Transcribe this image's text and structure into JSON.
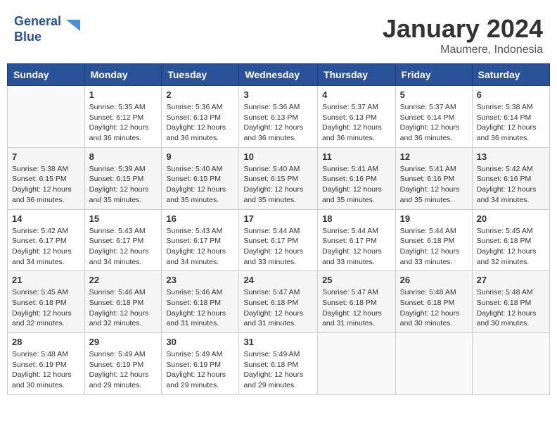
{
  "header": {
    "logo_line1": "General",
    "logo_line2": "Blue",
    "month_title": "January 2024",
    "subtitle": "Maumere, Indonesia"
  },
  "days_of_week": [
    "Sunday",
    "Monday",
    "Tuesday",
    "Wednesday",
    "Thursday",
    "Friday",
    "Saturday"
  ],
  "weeks": [
    [
      {
        "day": "",
        "sunrise": "",
        "sunset": "",
        "daylight": ""
      },
      {
        "day": "1",
        "sunrise": "Sunrise: 5:35 AM",
        "sunset": "Sunset: 6:12 PM",
        "daylight": "Daylight: 12 hours and 36 minutes."
      },
      {
        "day": "2",
        "sunrise": "Sunrise: 5:36 AM",
        "sunset": "Sunset: 6:13 PM",
        "daylight": "Daylight: 12 hours and 36 minutes."
      },
      {
        "day": "3",
        "sunrise": "Sunrise: 5:36 AM",
        "sunset": "Sunset: 6:13 PM",
        "daylight": "Daylight: 12 hours and 36 minutes."
      },
      {
        "day": "4",
        "sunrise": "Sunrise: 5:37 AM",
        "sunset": "Sunset: 6:13 PM",
        "daylight": "Daylight: 12 hours and 36 minutes."
      },
      {
        "day": "5",
        "sunrise": "Sunrise: 5:37 AM",
        "sunset": "Sunset: 6:14 PM",
        "daylight": "Daylight: 12 hours and 36 minutes."
      },
      {
        "day": "6",
        "sunrise": "Sunrise: 5:38 AM",
        "sunset": "Sunset: 6:14 PM",
        "daylight": "Daylight: 12 hours and 36 minutes."
      }
    ],
    [
      {
        "day": "7",
        "sunrise": "Sunrise: 5:38 AM",
        "sunset": "Sunset: 6:15 PM",
        "daylight": "Daylight: 12 hours and 36 minutes."
      },
      {
        "day": "8",
        "sunrise": "Sunrise: 5:39 AM",
        "sunset": "Sunset: 6:15 PM",
        "daylight": "Daylight: 12 hours and 35 minutes."
      },
      {
        "day": "9",
        "sunrise": "Sunrise: 5:40 AM",
        "sunset": "Sunset: 6:15 PM",
        "daylight": "Daylight: 12 hours and 35 minutes."
      },
      {
        "day": "10",
        "sunrise": "Sunrise: 5:40 AM",
        "sunset": "Sunset: 6:15 PM",
        "daylight": "Daylight: 12 hours and 35 minutes."
      },
      {
        "day": "11",
        "sunrise": "Sunrise: 5:41 AM",
        "sunset": "Sunset: 6:16 PM",
        "daylight": "Daylight: 12 hours and 35 minutes."
      },
      {
        "day": "12",
        "sunrise": "Sunrise: 5:41 AM",
        "sunset": "Sunset: 6:16 PM",
        "daylight": "Daylight: 12 hours and 35 minutes."
      },
      {
        "day": "13",
        "sunrise": "Sunrise: 5:42 AM",
        "sunset": "Sunset: 6:16 PM",
        "daylight": "Daylight: 12 hours and 34 minutes."
      }
    ],
    [
      {
        "day": "14",
        "sunrise": "Sunrise: 5:42 AM",
        "sunset": "Sunset: 6:17 PM",
        "daylight": "Daylight: 12 hours and 34 minutes."
      },
      {
        "day": "15",
        "sunrise": "Sunrise: 5:43 AM",
        "sunset": "Sunset: 6:17 PM",
        "daylight": "Daylight: 12 hours and 34 minutes."
      },
      {
        "day": "16",
        "sunrise": "Sunrise: 5:43 AM",
        "sunset": "Sunset: 6:17 PM",
        "daylight": "Daylight: 12 hours and 34 minutes."
      },
      {
        "day": "17",
        "sunrise": "Sunrise: 5:44 AM",
        "sunset": "Sunset: 6:17 PM",
        "daylight": "Daylight: 12 hours and 33 minutes."
      },
      {
        "day": "18",
        "sunrise": "Sunrise: 5:44 AM",
        "sunset": "Sunset: 6:17 PM",
        "daylight": "Daylight: 12 hours and 33 minutes."
      },
      {
        "day": "19",
        "sunrise": "Sunrise: 5:44 AM",
        "sunset": "Sunset: 6:18 PM",
        "daylight": "Daylight: 12 hours and 33 minutes."
      },
      {
        "day": "20",
        "sunrise": "Sunrise: 5:45 AM",
        "sunset": "Sunset: 6:18 PM",
        "daylight": "Daylight: 12 hours and 32 minutes."
      }
    ],
    [
      {
        "day": "21",
        "sunrise": "Sunrise: 5:45 AM",
        "sunset": "Sunset: 6:18 PM",
        "daylight": "Daylight: 12 hours and 32 minutes."
      },
      {
        "day": "22",
        "sunrise": "Sunrise: 5:46 AM",
        "sunset": "Sunset: 6:18 PM",
        "daylight": "Daylight: 12 hours and 32 minutes."
      },
      {
        "day": "23",
        "sunrise": "Sunrise: 5:46 AM",
        "sunset": "Sunset: 6:18 PM",
        "daylight": "Daylight: 12 hours and 31 minutes."
      },
      {
        "day": "24",
        "sunrise": "Sunrise: 5:47 AM",
        "sunset": "Sunset: 6:18 PM",
        "daylight": "Daylight: 12 hours and 31 minutes."
      },
      {
        "day": "25",
        "sunrise": "Sunrise: 5:47 AM",
        "sunset": "Sunset: 6:18 PM",
        "daylight": "Daylight: 12 hours and 31 minutes."
      },
      {
        "day": "26",
        "sunrise": "Sunrise: 5:48 AM",
        "sunset": "Sunset: 6:18 PM",
        "daylight": "Daylight: 12 hours and 30 minutes."
      },
      {
        "day": "27",
        "sunrise": "Sunrise: 5:48 AM",
        "sunset": "Sunset: 6:18 PM",
        "daylight": "Daylight: 12 hours and 30 minutes."
      }
    ],
    [
      {
        "day": "28",
        "sunrise": "Sunrise: 5:48 AM",
        "sunset": "Sunset: 6:19 PM",
        "daylight": "Daylight: 12 hours and 30 minutes."
      },
      {
        "day": "29",
        "sunrise": "Sunrise: 5:49 AM",
        "sunset": "Sunset: 6:19 PM",
        "daylight": "Daylight: 12 hours and 29 minutes."
      },
      {
        "day": "30",
        "sunrise": "Sunrise: 5:49 AM",
        "sunset": "Sunset: 6:19 PM",
        "daylight": "Daylight: 12 hours and 29 minutes."
      },
      {
        "day": "31",
        "sunrise": "Sunrise: 5:49 AM",
        "sunset": "Sunset: 6:18 PM",
        "daylight": "Daylight: 12 hours and 29 minutes."
      },
      {
        "day": "",
        "sunrise": "",
        "sunset": "",
        "daylight": ""
      },
      {
        "day": "",
        "sunrise": "",
        "sunset": "",
        "daylight": ""
      },
      {
        "day": "",
        "sunrise": "",
        "sunset": "",
        "daylight": ""
      }
    ]
  ]
}
